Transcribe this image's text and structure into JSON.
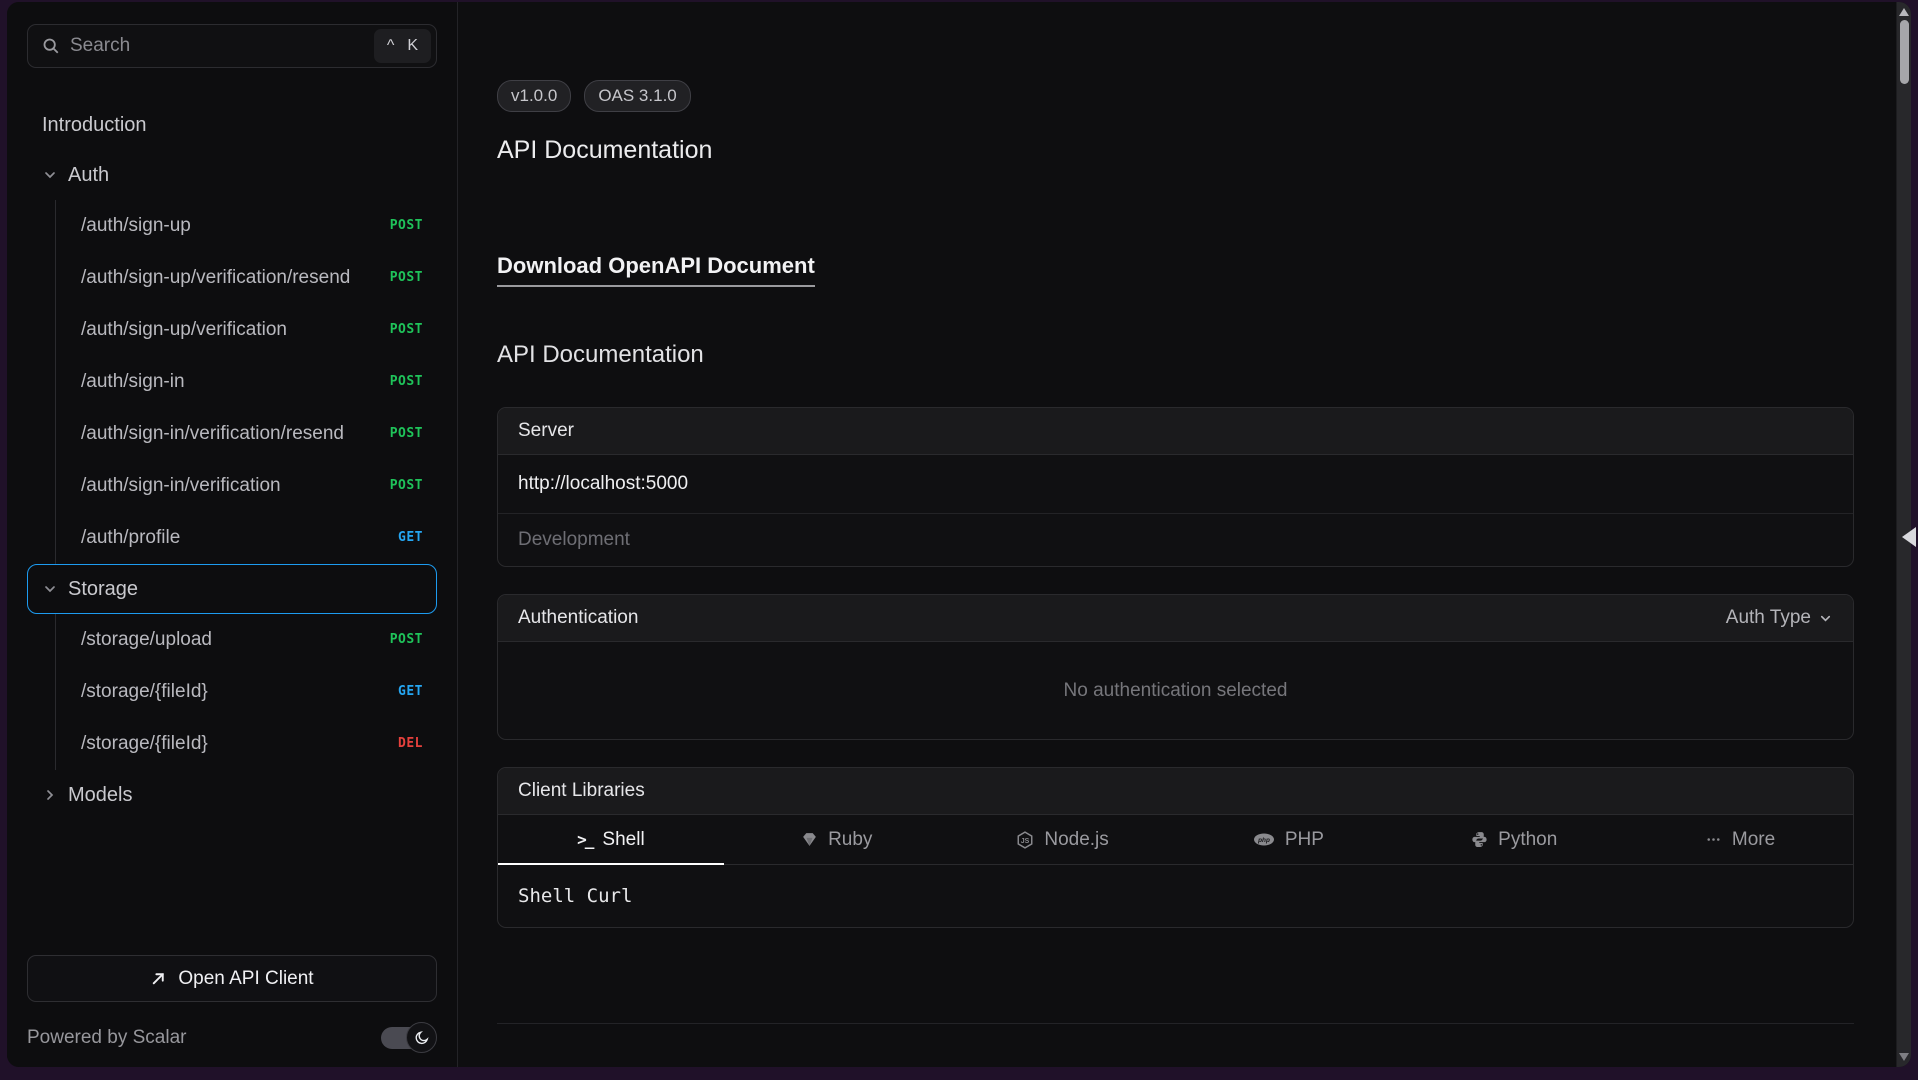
{
  "colors": {
    "accent_blue": "#1d9bf0",
    "method_post": "#1fc35a",
    "method_get": "#25a6f2",
    "method_del": "#e5403c",
    "frame_background": "#201129"
  },
  "sidebar": {
    "search": {
      "placeholder": "Search",
      "shortcut_mod": "^",
      "shortcut_key": "K"
    },
    "items": [
      {
        "label": "Introduction"
      },
      {
        "label": "Auth",
        "children": [
          {
            "path": "/auth/sign-up",
            "method": "POST"
          },
          {
            "path": "/auth/sign-up/verification/resend",
            "method": "POST"
          },
          {
            "path": "/auth/sign-up/verification",
            "method": "POST"
          },
          {
            "path": "/auth/sign-in",
            "method": "POST"
          },
          {
            "path": "/auth/sign-in/verification/resend",
            "method": "POST"
          },
          {
            "path": "/auth/sign-in/verification",
            "method": "POST"
          },
          {
            "path": "/auth/profile",
            "method": "GET"
          }
        ]
      },
      {
        "label": "Storage",
        "children": [
          {
            "path": "/storage/upload",
            "method": "POST"
          },
          {
            "path": "/storage/{fileId}",
            "method": "GET"
          },
          {
            "path": "/storage/{fileId}",
            "method": "DEL"
          }
        ]
      },
      {
        "label": "Models"
      }
    ],
    "open_api_client_label": "Open API Client",
    "powered_by": "Powered by Scalar"
  },
  "main": {
    "badges": {
      "version": "v1.0.0",
      "oas": "OAS 3.1.0"
    },
    "title": "API Documentation",
    "download_link": "Download OpenAPI Document",
    "section_title": "API Documentation",
    "server": {
      "header": "Server",
      "url": "http://localhost:5000",
      "description": "Development"
    },
    "authentication": {
      "header": "Authentication",
      "selector_label": "Auth Type",
      "empty_message": "No authentication selected"
    },
    "client_libraries": {
      "header": "Client Libraries",
      "tabs": [
        {
          "label": "Shell"
        },
        {
          "label": "Ruby"
        },
        {
          "label": "Node.js"
        },
        {
          "label": "PHP"
        },
        {
          "label": "Python"
        },
        {
          "label": "More"
        }
      ],
      "snippet": "Shell Curl"
    }
  }
}
